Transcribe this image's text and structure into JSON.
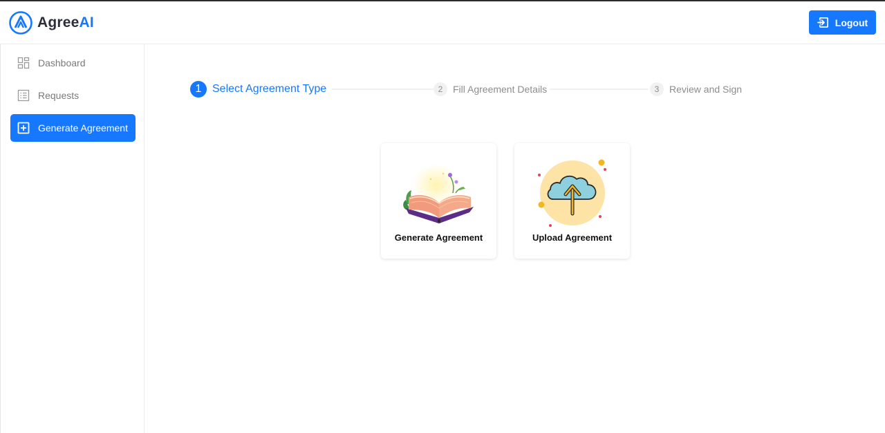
{
  "app": {
    "brand_part1": "Agree",
    "brand_part2": "AI"
  },
  "header": {
    "logout_label": "Logout"
  },
  "sidebar": {
    "items": [
      {
        "label": "Dashboard",
        "icon": "dashboard-icon",
        "active": false
      },
      {
        "label": "Requests",
        "icon": "list-icon",
        "active": false
      },
      {
        "label": "Generate Agreement",
        "icon": "plus-square-icon",
        "active": true
      }
    ]
  },
  "steps": [
    {
      "number": "1",
      "label": "Select Agreement Type",
      "status": "active"
    },
    {
      "number": "2",
      "label": "Fill Agreement Details",
      "status": "inactive"
    },
    {
      "number": "3",
      "label": "Review and Sign",
      "status": "inactive"
    }
  ],
  "options": [
    {
      "label": "Generate Agreement",
      "icon": "open-book-icon"
    },
    {
      "label": "Upload Agreement",
      "icon": "cloud-upload-icon"
    }
  ],
  "colors": {
    "accent": "#1677ff",
    "muted_text": "#8c8c8c"
  }
}
